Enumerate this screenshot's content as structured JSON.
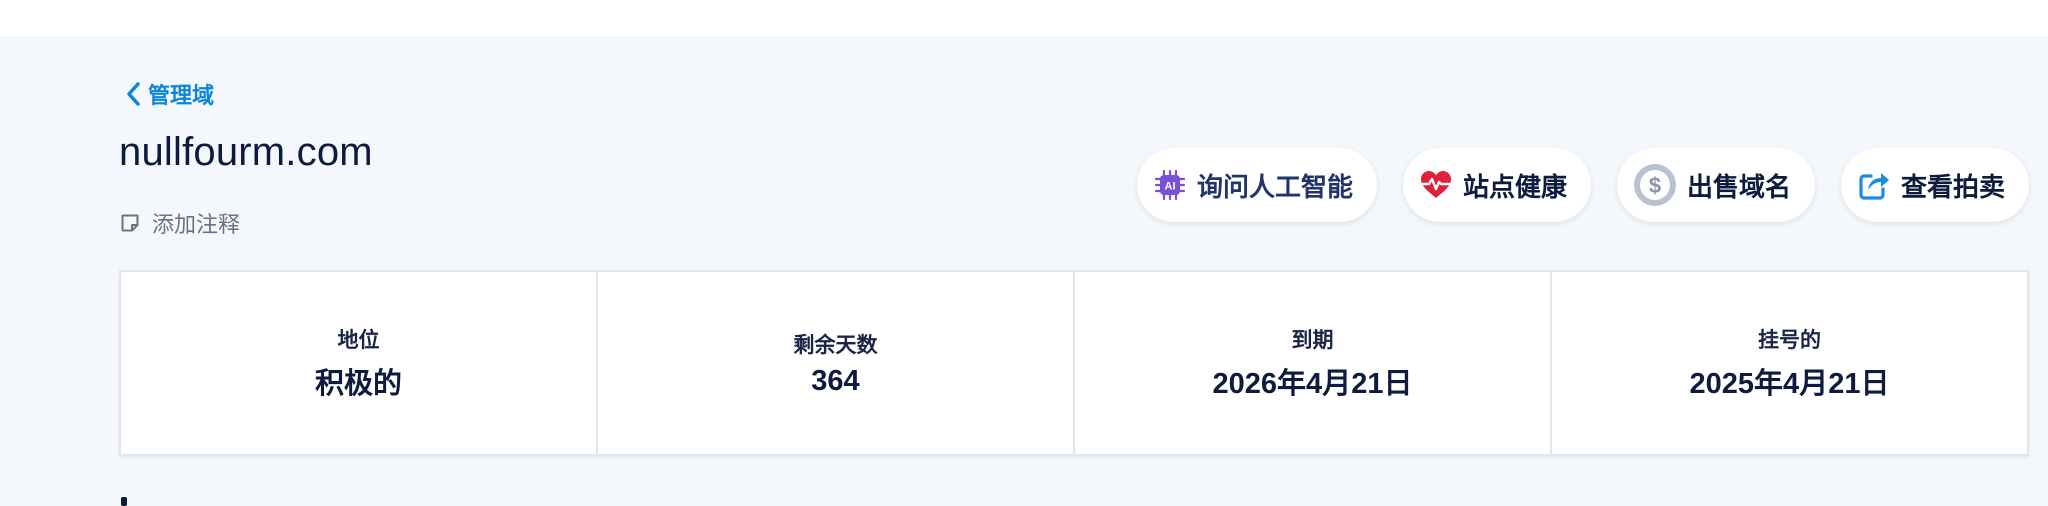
{
  "nav": {
    "back_label": "管理域"
  },
  "domain": {
    "name": "nullfourm.com",
    "add_note_label": "添加注释"
  },
  "actions": [
    {
      "label": "询问人工智能",
      "icon": "ai-chip-icon",
      "color": "#7b4fd6"
    },
    {
      "label": "站点健康",
      "icon": "heartbeat-icon",
      "color": "#e0213b"
    },
    {
      "label": "出售域名",
      "icon": "dollar-coin-icon",
      "color": "#9aa7b8"
    },
    {
      "label": "查看拍卖",
      "icon": "external-share-icon",
      "color": "#1a8be3"
    }
  ],
  "stats": [
    {
      "label": "地位",
      "value": "积极的"
    },
    {
      "label": "剩余天数",
      "value": "364"
    },
    {
      "label": "到期",
      "value": "2026年4月21日"
    },
    {
      "label": "挂号的",
      "value": "2025年4月21日"
    }
  ]
}
